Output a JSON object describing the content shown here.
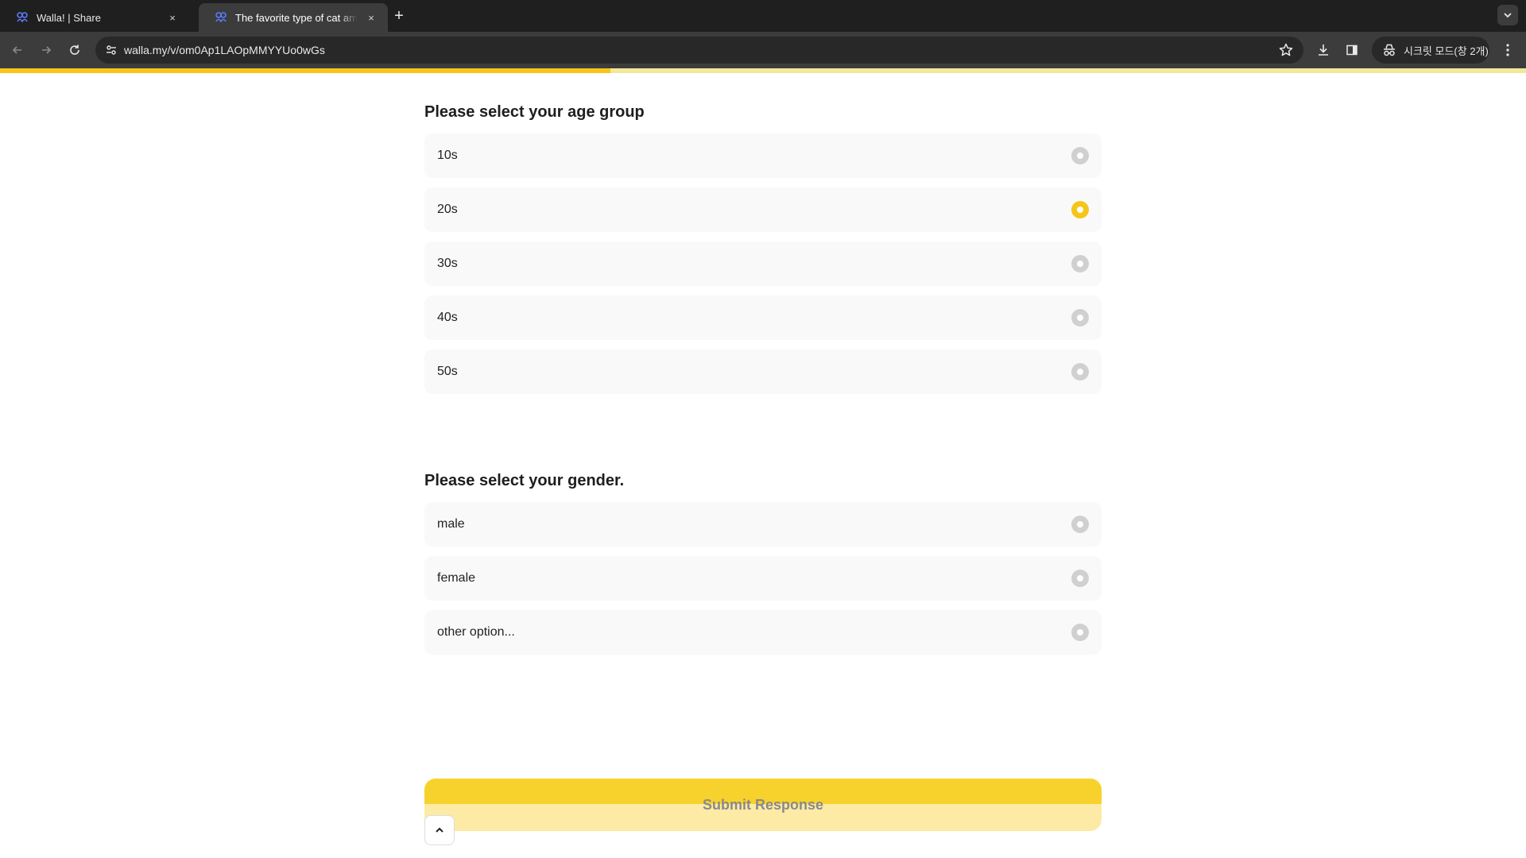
{
  "browser": {
    "tabs": [
      {
        "title": "Walla! | Share",
        "close": "×"
      },
      {
        "title": "The favorite type of cat among",
        "close": "×"
      }
    ],
    "new_tab": "+",
    "url": "walla.my/v/om0Ap1LAOpMMYYUo0wGs",
    "incognito_label": "시크릿 모드(창 2개)",
    "progress_fraction": 0.4
  },
  "colors": {
    "accent": "#f5c518",
    "accent_light": "#fdeaa5",
    "option_bg": "#f9f9f9",
    "radio_unselected": "#d0d0d0"
  },
  "questions": [
    {
      "title": "Please select your age group",
      "options": [
        {
          "label": "10s",
          "selected": false
        },
        {
          "label": "20s",
          "selected": true
        },
        {
          "label": "30s",
          "selected": false
        },
        {
          "label": "40s",
          "selected": false
        },
        {
          "label": "50s",
          "selected": false
        }
      ]
    },
    {
      "title": "Please select your gender.",
      "options": [
        {
          "label": "male",
          "selected": false
        },
        {
          "label": "female",
          "selected": false
        },
        {
          "label": "other option...",
          "selected": false
        }
      ]
    }
  ],
  "submit_label": "Submit Response",
  "icons": {
    "tab_favicon": "walla-logo-icon",
    "back": "arrow-left-icon",
    "forward": "arrow-right-icon",
    "reload": "reload-icon",
    "site_info": "tune-icon",
    "bookmark": "star-icon",
    "download": "download-icon",
    "side_panel": "side-panel-icon",
    "incognito": "incognito-icon",
    "menu": "kebab-menu-icon",
    "scroll_top": "chevron-up-icon"
  }
}
